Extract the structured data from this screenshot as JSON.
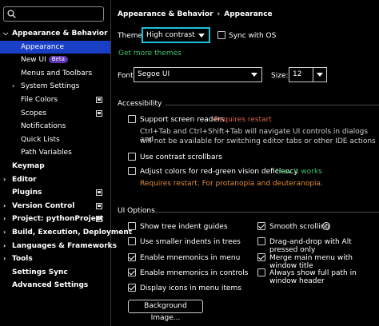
{
  "sidebar": {
    "search_placeholder": "",
    "items": [
      {
        "label": "Appearance & Behavior",
        "expanded": true
      },
      {
        "label": "Appearance",
        "selected": true
      },
      {
        "label": "New UI",
        "badge": "Beta"
      },
      {
        "label": "Menus and Toolbars"
      },
      {
        "label": "System Settings",
        "collapsed": true
      },
      {
        "label": "File Colors",
        "pin": true
      },
      {
        "label": "Scopes",
        "pin": true
      },
      {
        "label": "Notifications"
      },
      {
        "label": "Quick Lists"
      },
      {
        "label": "Path Variables"
      },
      {
        "label": "Keymap"
      },
      {
        "label": "Editor"
      },
      {
        "label": "Plugins",
        "pin": true
      },
      {
        "label": "Version Control",
        "pin": true
      },
      {
        "label": "Project: pythonProject",
        "pin": true
      },
      {
        "label": "Build, Execution, Deployment"
      },
      {
        "label": "Languages & Frameworks"
      },
      {
        "label": "Tools"
      },
      {
        "label": "Settings Sync"
      },
      {
        "label": "Advanced Settings"
      }
    ]
  },
  "breadcrumb": {
    "parent": "Appearance & Behavior",
    "sep": "›",
    "current": "Appearance"
  },
  "theme": {
    "label": "Theme:",
    "value": "High contrast",
    "sync_label": "Sync with OS",
    "sync_checked": false,
    "get_more": "Get more themes"
  },
  "font": {
    "label": "Font:",
    "value": "Segoe UI",
    "size_label": "Size:",
    "size_value": "12"
  },
  "accessibility": {
    "title": "Accessibility",
    "screen_readers": {
      "label": "Support screen readers",
      "checked": false,
      "requires": "Requires restart",
      "desc_line1": "Ctrl+Tab and Ctrl+Shift+Tab will navigate UI controls in dialogs and",
      "desc_line2": "will not be available for switching editor tabs or other IDE actions"
    },
    "contrast_scrollbars": {
      "label": "Use contrast scrollbars",
      "checked": false
    },
    "color_deficiency": {
      "label": "Adjust colors for red-green vision deficiency",
      "checked": false,
      "link": "How it works",
      "note": "Requires restart. For protanopia and deuteranopia."
    }
  },
  "ui_options": {
    "title": "UI Options",
    "left": [
      {
        "label": "Show tree indent guides",
        "checked": false
      },
      {
        "label": "Use smaller indents in trees",
        "checked": false
      },
      {
        "label": "Enable mnemonics in menu",
        "checked": true
      },
      {
        "label": "Enable mnemonics in controls",
        "checked": true
      },
      {
        "label": "Display icons in menu items",
        "checked": true
      }
    ],
    "right": [
      {
        "label": "Smooth scrolling",
        "checked": true,
        "help": "?"
      },
      {
        "label": "Drag-and-drop with Alt pressed only",
        "checked": false
      },
      {
        "label": "Merge main menu with window title",
        "checked": true
      },
      {
        "label": "Always show full path in window header",
        "checked": false
      }
    ],
    "background_button": "Background Image..."
  }
}
